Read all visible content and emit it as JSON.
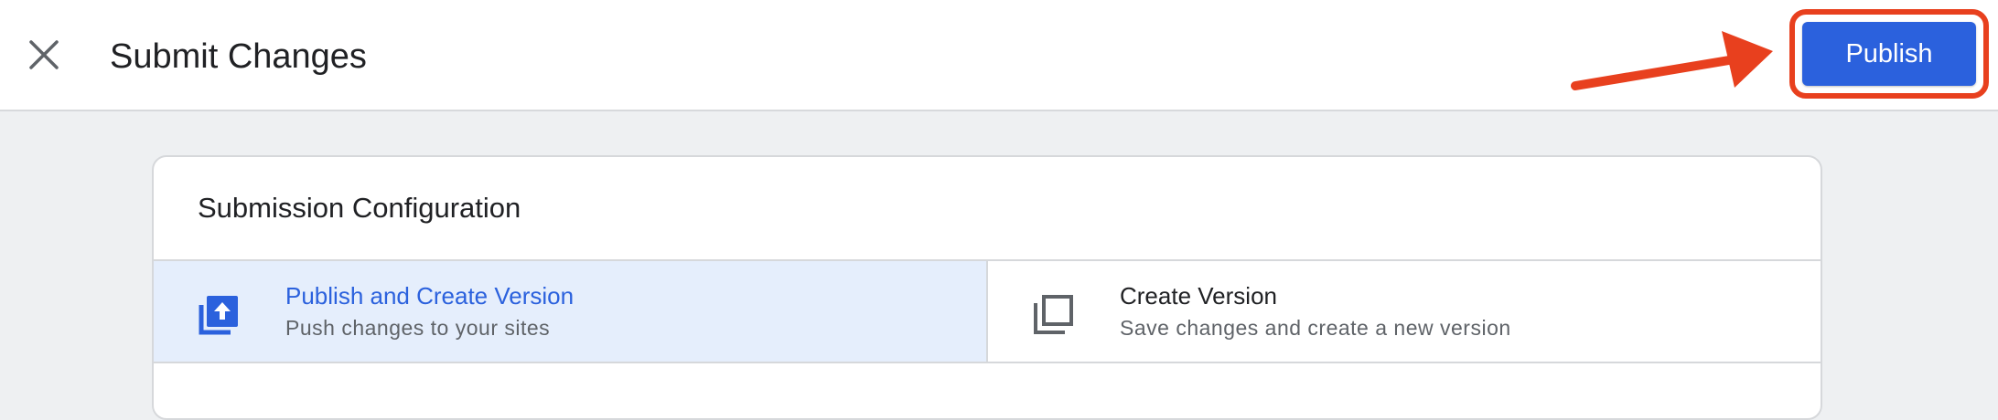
{
  "header": {
    "title": "Submit Changes",
    "close_icon": "close-icon",
    "publish_label": "Publish"
  },
  "annotation": {
    "arrow_color": "#e8401e",
    "highlight_color": "#e8401e"
  },
  "colors": {
    "accent": "#2b61dd",
    "selected_bg": "#e5eefc"
  },
  "config": {
    "title": "Submission Configuration",
    "options": [
      {
        "title": "Publish and Create Version",
        "subtitle": "Push changes to your sites",
        "icon": "publish-icon",
        "selected": true
      },
      {
        "title": "Create Version",
        "subtitle": "Save changes and create a new version",
        "icon": "copy-icon",
        "selected": false
      }
    ]
  }
}
